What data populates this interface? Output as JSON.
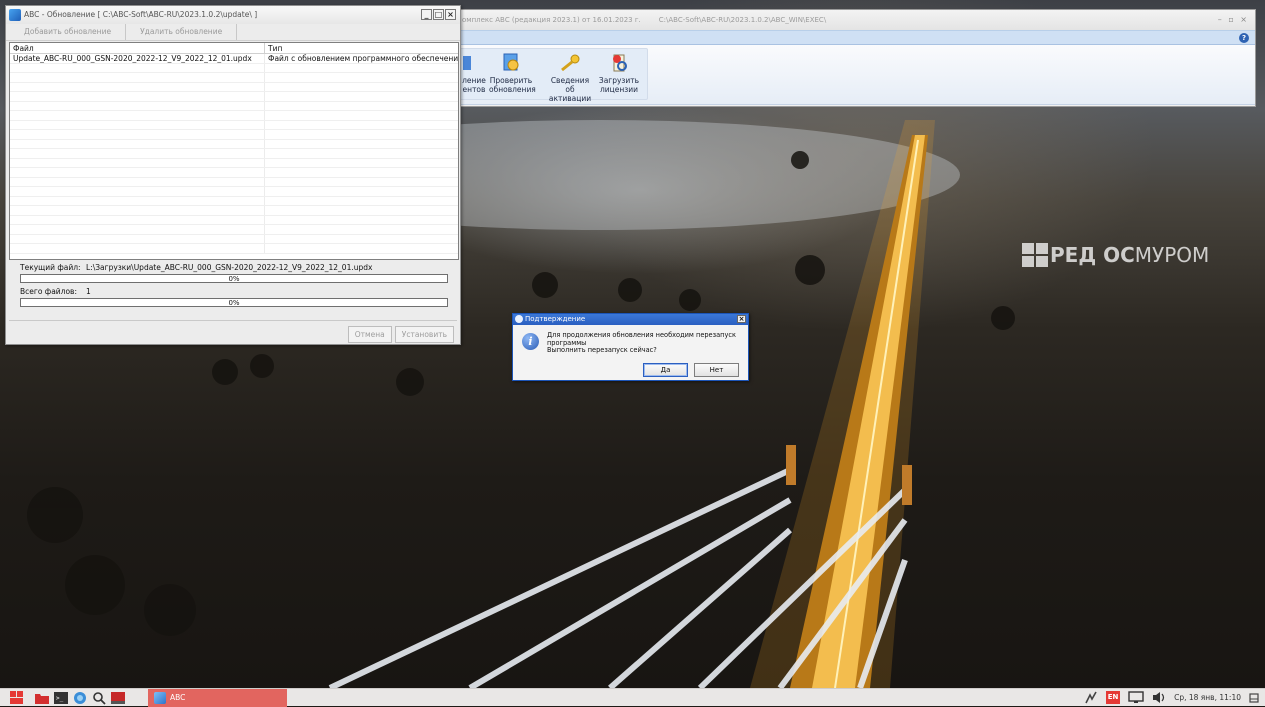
{
  "main_window": {
    "title": "омплекс АВС (редакция 2023.1) от 16.01.2023 г.",
    "path": "C:\\ABC-Soft\\ABC-RU\\2023.1.0.2\\ABC_WIN\\EXEC\\",
    "ribbon": {
      "partial_button_line1": "ление",
      "partial_button_line2": "ентов",
      "check_updates_line1": "Проверить",
      "check_updates_line2": "обновления",
      "activation_line1": "Сведения об",
      "activation_line2": "активации",
      "load_license_line1": "Загрузить",
      "load_license_line2": "лицензии"
    },
    "help_icon": "?"
  },
  "update_window": {
    "title": "ABC - Обновление [ C:\\ABC-Soft\\ABC-RU\\2023.1.0.2\\update\\ ]",
    "toolbar": {
      "add_update": "Добавить обновление",
      "remove_update": "Удалить обновление"
    },
    "table": {
      "columns": [
        "Файл",
        "Тип"
      ],
      "rows": [
        {
          "file": "Update_ABC-RU_000_GSN-2020_2022-12_V9_2022_12_01.updx",
          "type": "Файл с обновлением программного обеспечения"
        }
      ]
    },
    "current_file_label": "Текущий файл:",
    "current_file_value": "L:\\Загрузки\\Update_ABC-RU_000_GSN-2020_2022-12_V9_2022_12_01.updx",
    "current_progress_text": "0%",
    "current_progress_fraction": 0,
    "total_files_label": "Всего файлов:",
    "total_files_value": "1",
    "total_progress_text": "0%",
    "total_progress_fraction": 0,
    "cancel_button": "Отмена",
    "install_button": "Установить"
  },
  "confirm_dialog": {
    "title": "Подтверждение",
    "message_line1": "Для продолжения обновления необходим перезапуск",
    "message_line2": "программы",
    "message_line3": "Выполнить перезапуск сейчас?",
    "yes_button": "Да",
    "no_button": "Нет"
  },
  "desktop": {
    "logo_text_bold": "РЕД ОС",
    "logo_text_thin": "МУРОМ"
  },
  "taskbar": {
    "task_label": "ABC",
    "language": "EN",
    "clock": "Ср, 18 янв, 11:10"
  },
  "colors": {
    "taskbar_active_task": "#e2655f",
    "dialog_titlebar": "#2a5fc1",
    "ribbon_background": "#e6edf6"
  }
}
